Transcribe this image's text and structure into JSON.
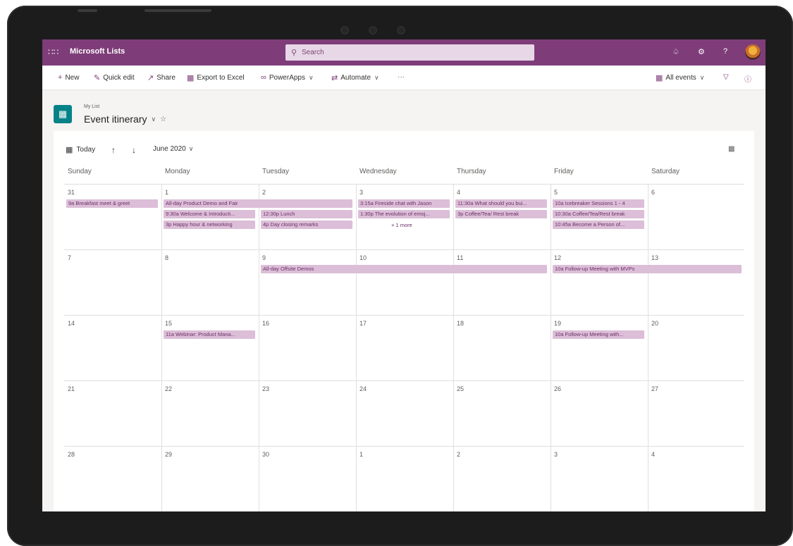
{
  "suitebar": {
    "app_name": "Microsoft Lists",
    "search_placeholder": "Search",
    "colors": {
      "brand": "#7e3d79",
      "search_bg": "#e8d7e6"
    },
    "icons": [
      "waffle-icon",
      "bell-icon",
      "gear-icon",
      "help-icon"
    ]
  },
  "commandbar": {
    "new": "New",
    "quick_edit": "Quick edit",
    "share": "Share",
    "export": "Export to Excel",
    "powerapps": "PowerApps",
    "automate": "Automate",
    "more": "···",
    "view": "All events"
  },
  "list": {
    "subtitle": "My List",
    "title": "Event itinerary"
  },
  "calendar": {
    "today_label": "Today",
    "month_label": "June 2020",
    "event_color": "#dcbed8",
    "day_names": [
      "Sunday",
      "Monday",
      "Tuesday",
      "Wednesday",
      "Thursday",
      "Friday",
      "Saturday"
    ],
    "weeks": [
      [
        "31",
        "1",
        "2",
        "3",
        "4",
        "5",
        "6"
      ],
      [
        "7",
        "8",
        "9",
        "10",
        "11",
        "12",
        "13"
      ],
      [
        "14",
        "15",
        "16",
        "17",
        "18",
        "19",
        "20"
      ],
      [
        "21",
        "22",
        "23",
        "24",
        "25",
        "26",
        "27"
      ],
      [
        "28",
        "29",
        "30",
        "1",
        "2",
        "3",
        "4"
      ]
    ],
    "events": [
      {
        "week": 0,
        "day": 0,
        "span": 1,
        "slot": 0,
        "text": "9a Breakfast meet & greet"
      },
      {
        "week": 0,
        "day": 1,
        "span": 2,
        "slot": 0,
        "text": "All-day Product Demo and Fair"
      },
      {
        "week": 0,
        "day": 1,
        "span": 1,
        "slot": 1,
        "text": "9:30a Welcome & Introducti..."
      },
      {
        "week": 0,
        "day": 1,
        "span": 1,
        "slot": 2,
        "text": "3p Happy hour & networking"
      },
      {
        "week": 0,
        "day": 2,
        "span": 1,
        "slot": 1,
        "text": "12:30p Lunch"
      },
      {
        "week": 0,
        "day": 2,
        "span": 1,
        "slot": 2,
        "text": "4p Day closing remarks"
      },
      {
        "week": 0,
        "day": 3,
        "span": 1,
        "slot": 0,
        "text": "3:15a Fireside chat with Jason"
      },
      {
        "week": 0,
        "day": 3,
        "span": 1,
        "slot": 1,
        "text": "1:30p The evolution of emoj..."
      },
      {
        "week": 0,
        "day": 4,
        "span": 1,
        "slot": 0,
        "text": "11:30a What should you bui..."
      },
      {
        "week": 0,
        "day": 4,
        "span": 1,
        "slot": 1,
        "text": "3p Coffee/Tea/ Rest break"
      },
      {
        "week": 0,
        "day": 5,
        "span": 1,
        "slot": 0,
        "text": "10a Icebreaker Sessions 1 - 4"
      },
      {
        "week": 0,
        "day": 5,
        "span": 1,
        "slot": 1,
        "text": "10:30a Coffee/Tea/Rest break"
      },
      {
        "week": 0,
        "day": 5,
        "span": 1,
        "slot": 2,
        "text": "10:45a Become a Person of..."
      },
      {
        "week": 1,
        "day": 2,
        "span": 3,
        "slot": 0,
        "text": "All-day Offsite Demos"
      },
      {
        "week": 1,
        "day": 5,
        "span": 2,
        "slot": 0,
        "text": "10a Follow-up Meeting with MVPs"
      },
      {
        "week": 2,
        "day": 1,
        "span": 1,
        "slot": 0,
        "text": "11a Webinar: Product Mana..."
      },
      {
        "week": 2,
        "day": 5,
        "span": 1,
        "slot": 0,
        "text": "10a Follow-up Meeting with..."
      }
    ],
    "more": {
      "week": 0,
      "day": 3,
      "slot": 2,
      "text": "+ 1 more"
    }
  }
}
